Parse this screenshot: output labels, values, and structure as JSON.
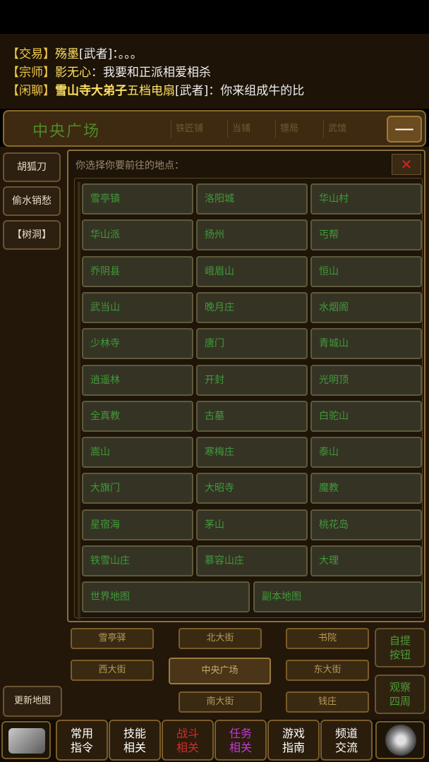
{
  "chat": {
    "lines": [
      {
        "tag": "",
        "name": "",
        "text": ""
      },
      {
        "tag": "【交易】",
        "name": "殇墨",
        "role": "[武者]",
        "text": "：。。。"
      },
      {
        "tag": "【宗师】",
        "name": "影无心",
        "role": "",
        "text": "：我要和正派相爱相杀"
      },
      {
        "tag": "【闲聊】",
        "name": "雪山寺大弟子",
        "name2": "五档电扇",
        "role": "[武者]",
        "text": "：你来组成牛的比"
      }
    ]
  },
  "header": {
    "title": "中央广场",
    "tabs": [
      "铁匠铺",
      "当铺",
      "镖局",
      "武馆"
    ],
    "collapse": "—"
  },
  "side": {
    "btn1": "胡狐刀",
    "btn2": "偷水销愁",
    "btn3": "【树洞】",
    "refresh": "更新地图"
  },
  "map": {
    "prompt": "你选择你要前往的地点：",
    "close": "✕",
    "locations": [
      [
        "雪亭镇",
        "洛阳城",
        "华山村"
      ],
      [
        "华山派",
        "扬州",
        "丐帮"
      ],
      [
        "乔阴县",
        "峨眉山",
        "恒山"
      ],
      [
        "武当山",
        "晚月庄",
        "水烟阁"
      ],
      [
        "少林寺",
        "唐门",
        "青城山"
      ],
      [
        "逍遥林",
        "开封",
        "光明顶"
      ],
      [
        "全真教",
        "古墓",
        "白驼山"
      ],
      [
        "嵩山",
        "寒梅庄",
        "泰山"
      ],
      [
        "大旗门",
        "大昭寺",
        "魔教"
      ],
      [
        "星宿海",
        "茅山",
        "桃花岛"
      ],
      [
        "铁雪山庄",
        "慕容山庄",
        "大理"
      ]
    ],
    "wide": [
      "世界地图",
      "副本地图"
    ]
  },
  "nav": {
    "n1": "雪亭驿",
    "n2": "北大街",
    "n3": "书院",
    "n4": "西大街",
    "center": "中央广场",
    "n5": "东大街",
    "n6": "南大街",
    "n7": "钱庄"
  },
  "right": {
    "r1": "自提\n按钮",
    "r2": "观察\n四周"
  },
  "bottom": {
    "b1": "常用\n指令",
    "b2": "技能\n相关",
    "b3": "战斗\n相关",
    "b4": "任务\n相关",
    "b5": "游戏\n指南",
    "b6": "频道\n交流"
  },
  "colors": {
    "accent_green": "#3f9a3a",
    "chat_name": "#ffe065",
    "battle_red": "#d62a2a",
    "task_purple": "#c23ad6"
  }
}
